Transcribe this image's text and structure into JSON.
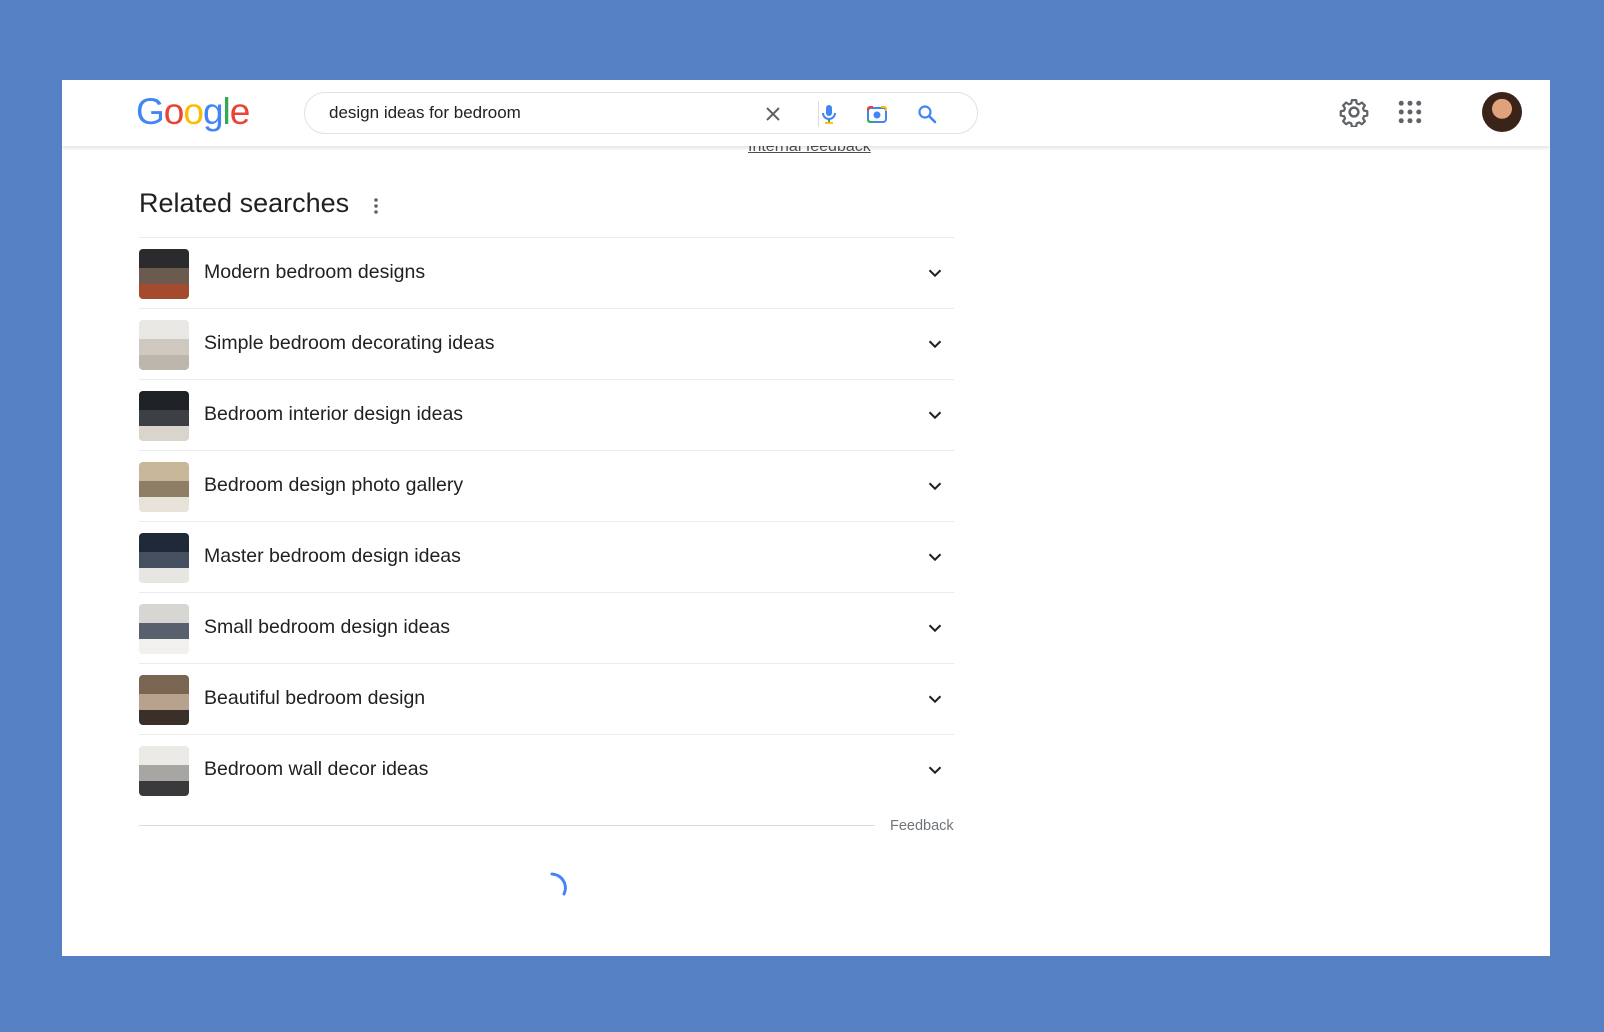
{
  "header": {
    "logo": {
      "letters": [
        "G",
        "o",
        "o",
        "g",
        "l",
        "e"
      ],
      "colors": [
        "#4285f4",
        "#ea4335",
        "#fbbc05",
        "#4285f4",
        "#34a853",
        "#ea4335"
      ]
    },
    "search": {
      "query": "design ideas for bedroom",
      "icons": [
        "close-icon",
        "microphone-icon",
        "lens-camera-icon",
        "search-icon"
      ]
    },
    "right_icons": [
      "settings-gear-icon",
      "apps-grid-icon",
      "avatar"
    ]
  },
  "internal_feedback_label": "Internal feedback",
  "related_searches": {
    "title": "Related searches",
    "items": [
      {
        "label": "Modern bedroom designs",
        "thumb_colors": [
          "#2b2a2c",
          "#6b5a4e",
          "#a44a2e"
        ]
      },
      {
        "label": "Simple bedroom decorating ideas",
        "thumb_colors": [
          "#e9e7e3",
          "#cfc9c1",
          "#bdb6ad"
        ]
      },
      {
        "label": "Bedroom interior design ideas",
        "thumb_colors": [
          "#1e2226",
          "#3c3f44",
          "#d9d4cc"
        ]
      },
      {
        "label": "Bedroom design photo gallery",
        "thumb_colors": [
          "#c9b79a",
          "#8f7e66",
          "#e8e3da"
        ]
      },
      {
        "label": "Master bedroom design ideas",
        "thumb_colors": [
          "#1f2937",
          "#44505f",
          "#e8e6e2"
        ]
      },
      {
        "label": "Small bedroom design ideas",
        "thumb_colors": [
          "#d8d6d2",
          "#57606c",
          "#f2f0ec"
        ]
      },
      {
        "label": "Beautiful bedroom design",
        "thumb_colors": [
          "#7a6553",
          "#b7a38d",
          "#3b3029"
        ]
      },
      {
        "label": "Bedroom wall decor ideas",
        "thumb_colors": [
          "#ebeae7",
          "#a8a6a2",
          "#3a3a3c"
        ]
      }
    ]
  },
  "feedback_label": "Feedback",
  "loading": true,
  "colors": {
    "background": "#5580c4",
    "text": "#202124",
    "muted": "#70757a",
    "spinner": "#4285f4"
  }
}
